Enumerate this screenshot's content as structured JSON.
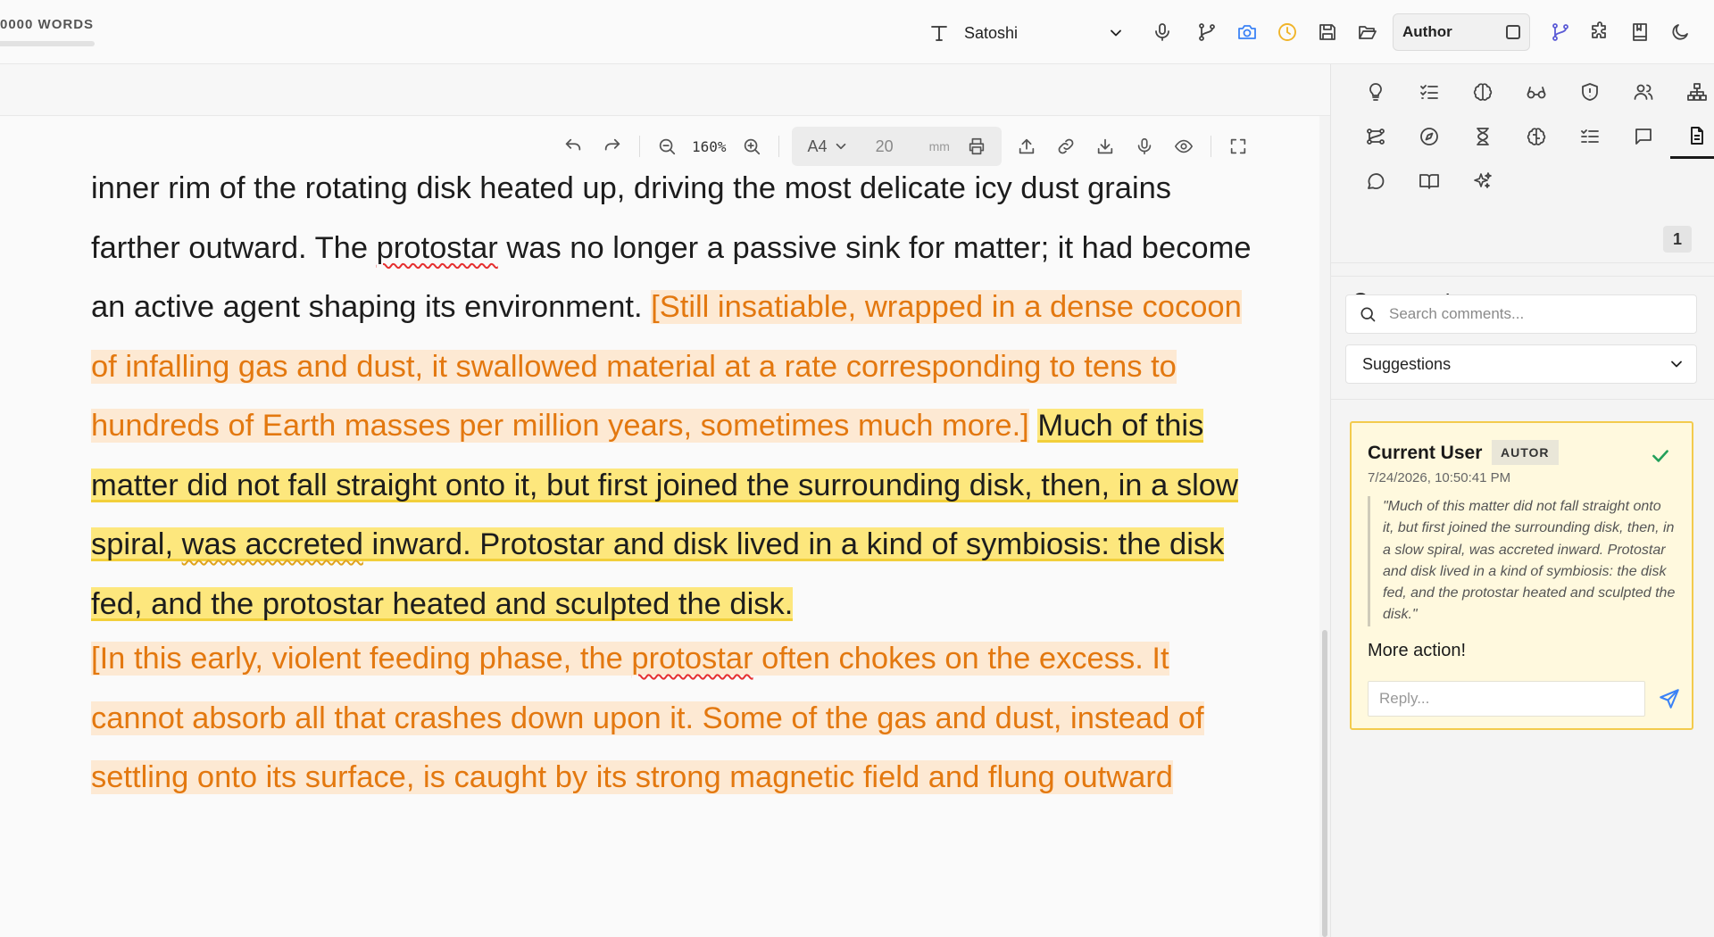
{
  "topbar": {
    "word_count": "0000 WORDS",
    "font_name": "Satoshi",
    "role_label": "Author"
  },
  "doc_toolbar": {
    "zoom": "160%",
    "page_size": "A4",
    "margin_value": "20",
    "margin_unit": "mm"
  },
  "document": {
    "top_fragment": ", ",
    "p1": {
      "l1": " inner rim of the rotating disk heated up, driving the most delicate icy dust grains farther outward. The ",
      "typo1": "protostar",
      "l2": " was no longer a passive sink for matter; it had become an active agent shaping its environment. ",
      "insert1": "[Still insatiable, wrapped in a dense cocoon of infalling gas and dust, it swallowed material at a rate corresponding to tens to hundreds of Earth masses per million years, sometimes much more.]",
      "space": " ",
      "hl_a": "Much of this matter did not fall straight onto it, but first joined the surrounding disk, then, in a slow spiral, ",
      "hl_gram": "was accreted",
      "hl_b": " inward. Protostar and disk lived in a kind of symbiosis: the disk fed, and the protostar heated and sculpted the disk."
    },
    "p2": {
      "a": "[In this early, violent feeding phase, the ",
      "typo": "protostar",
      "b": " often chokes on the excess. It cannot absorb all that crashes down upon it. Some of the gas and dust, instead of  settling onto its surface,  is caught  by its strong magnetic field and flung outward"
    }
  },
  "sidebar": {
    "comments_title": "Comments",
    "comments_count": "1",
    "search_placeholder": "Search comments...",
    "filter_value": "Suggestions",
    "card": {
      "author": "Current User",
      "badge": "AUTOR",
      "date": "7/24/2026, 10:50:41 PM",
      "quote": "\"Much of this matter did not fall straight onto it, but first joined the surrounding disk, then, in a slow spiral, was accreted inward. Protostar and disk lived in a kind of symbiosis: the disk fed, and the protostar heated and sculpted the disk.\"",
      "message": "More action!",
      "reply_placeholder": "Reply..."
    }
  },
  "colors": {
    "insertion_text": "#e3780f",
    "insertion_bg": "#fde9d3",
    "highlight_bg": "#fde77d",
    "card_bg": "#fff9de",
    "card_border": "#f3cb4d",
    "accent_blue": "#3b82f6",
    "accent_amber": "#f0b429",
    "check_green": "#22a05a"
  },
  "icons": {
    "topbar": [
      "text-type-icon",
      "chevron-down-icon",
      "microphone-icon",
      "git-branch-icon",
      "camera-icon",
      "clock-icon",
      "save-icon",
      "folder-open-icon",
      "git-branch-active-icon",
      "puzzle-icon",
      "book-bookmark-icon",
      "moon-icon"
    ],
    "doc_toolbar": [
      "undo-icon",
      "redo-icon",
      "zoom-out-icon",
      "zoom-in-icon",
      "printer-icon",
      "upload-icon",
      "link-icon",
      "download-icon",
      "microphone-icon",
      "eye-icon",
      "fullscreen-icon"
    ],
    "sidebar_tools": [
      "lightbulb-icon",
      "list-check-icon",
      "brain-icon",
      "glasses-icon",
      "shield-icon",
      "users-icon",
      "sitemap-icon",
      "workflow-icon",
      "compass-icon",
      "hourglass-icon",
      "brain-circuit-icon",
      "list-check-alt-icon",
      "message-square-icon",
      "document-icon",
      "message-circle-icon",
      "book-open-icon",
      "sparkles-icon"
    ]
  }
}
